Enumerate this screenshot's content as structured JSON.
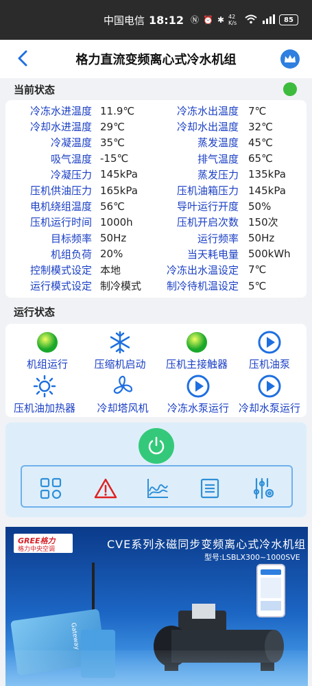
{
  "status_bar": {
    "carrier": "中国电信",
    "time": "18:12",
    "net_speed": "42 K/s",
    "battery": "85"
  },
  "header": {
    "title": "格力直流变频离心式冷水机组"
  },
  "current_status": {
    "title": "当前状态",
    "indicator_color": "#3dbb3d",
    "rows": [
      {
        "l1": "冷冻水进温度",
        "v1": "11.9℃",
        "l2": "冷冻水出温度",
        "v2": "7℃"
      },
      {
        "l1": "冷却水进温度",
        "v1": "29℃",
        "l2": "冷却水出温度",
        "v2": "32℃"
      },
      {
        "l1": "冷凝温度",
        "v1": "35℃",
        "l2": "蒸发温度",
        "v2": "45℃"
      },
      {
        "l1": "吸气温度",
        "v1": "-15℃",
        "l2": "排气温度",
        "v2": "65℃"
      },
      {
        "l1": "冷凝压力",
        "v1": "145kPa",
        "l2": "蒸发压力",
        "v2": "135kPa"
      },
      {
        "l1": "压机供油压力",
        "v1": "165kPa",
        "l2": "压机油箱压力",
        "v2": "145kPa"
      },
      {
        "l1": "电机绕组温度",
        "v1": "56℃",
        "l2": "导叶运行开度",
        "v2": "50%"
      },
      {
        "l1": "压机运行时间",
        "v1": "1000h",
        "l2": "压机开启次数",
        "v2": "150次"
      },
      {
        "l1": "目标频率",
        "v1": "50Hz",
        "l2": "运行频率",
        "v2": "50Hz"
      },
      {
        "l1": "机组负荷",
        "v1": "20%",
        "l2": "当天耗电量",
        "v2": "500kWh"
      },
      {
        "l1": "控制模式设定",
        "v1": "本地",
        "l2": "冷冻出水温设定",
        "v2": "7℃"
      },
      {
        "l1": "运行模式设定",
        "v1": "制冷模式",
        "l2": "制冷待机温设定",
        "v2": "5℃"
      }
    ]
  },
  "run_status": {
    "title": "运行状态",
    "items": [
      {
        "label": "机组运行",
        "icon": "green-status-icon"
      },
      {
        "label": "压缩机启动",
        "icon": "snowflake-icon"
      },
      {
        "label": "压机主接触器",
        "icon": "green-status-icon"
      },
      {
        "label": "压机油泵",
        "icon": "play-icon"
      },
      {
        "label": "压机油加热器",
        "icon": "sun-icon"
      },
      {
        "label": "冷却塔风机",
        "icon": "fan-icon"
      },
      {
        "label": "冷冻水泵运行",
        "icon": "play-icon"
      },
      {
        "label": "冷却水泵运行",
        "icon": "play-icon"
      }
    ]
  },
  "colors": {
    "label_blue": "#1a3fc4",
    "accent_blue": "#1e6fe0",
    "power_green": "#34c97a",
    "alarm_red": "#e02020"
  },
  "banner": {
    "logo_top": "GREE格力",
    "logo_bottom": "格力中央空调",
    "headline": "CVE系列永磁同步变频离心式冷水机组",
    "model": "型号:LSBLX300~1000SVE",
    "gateway_label": "Gateway"
  }
}
